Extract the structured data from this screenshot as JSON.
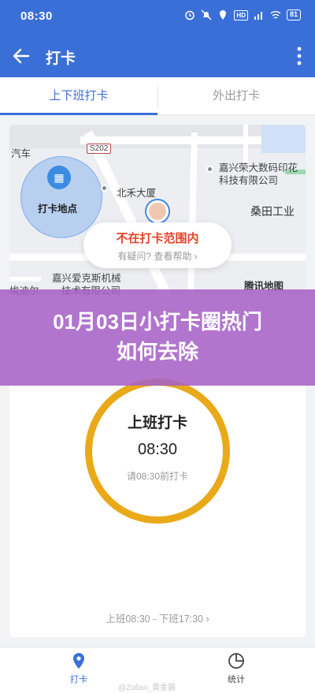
{
  "status_bar": {
    "time": "08:30",
    "network": "HD",
    "battery": "81"
  },
  "app_bar": {
    "title": "打卡"
  },
  "tabs": [
    {
      "label": "上下班打卡",
      "active": true
    },
    {
      "label": "外出打卡",
      "active": false
    }
  ],
  "map": {
    "road_tag": "S202",
    "checkpoint_label": "打卡地点",
    "labels": {
      "car": "汽车",
      "beihe": "北禾大厦",
      "jiaxing_rongda_1": "嘉兴荣大数码印花",
      "jiaxing_rongda_2": "科技有限公司",
      "sangtian": "桑田工业",
      "di_er": "埃迪尔",
      "aike_1": "嘉兴爱克斯机械",
      "aike_2": "技术有限公司"
    },
    "notice_title": "不在打卡范围内",
    "notice_sub": "有疑问? 查看帮助",
    "notice_chevron": "›",
    "provider": "腾讯地图"
  },
  "banner": {
    "line1": "01月03日小打卡圈热门",
    "line2": "如何去除"
  },
  "clock_in": {
    "label": "上班打卡",
    "time": "08:30",
    "hint": "请08:30前打卡"
  },
  "shift_info": "上班08:30 - 下班17:30 ›",
  "bottom_nav": {
    "left_label": "打卡",
    "right_label": "统计",
    "watermark": "@Zollan_黄金菌"
  },
  "colors": {
    "primary": "#3a6fd8",
    "ring": "#e9a919",
    "warning": "#e2452a",
    "banner": "#a662c6"
  }
}
